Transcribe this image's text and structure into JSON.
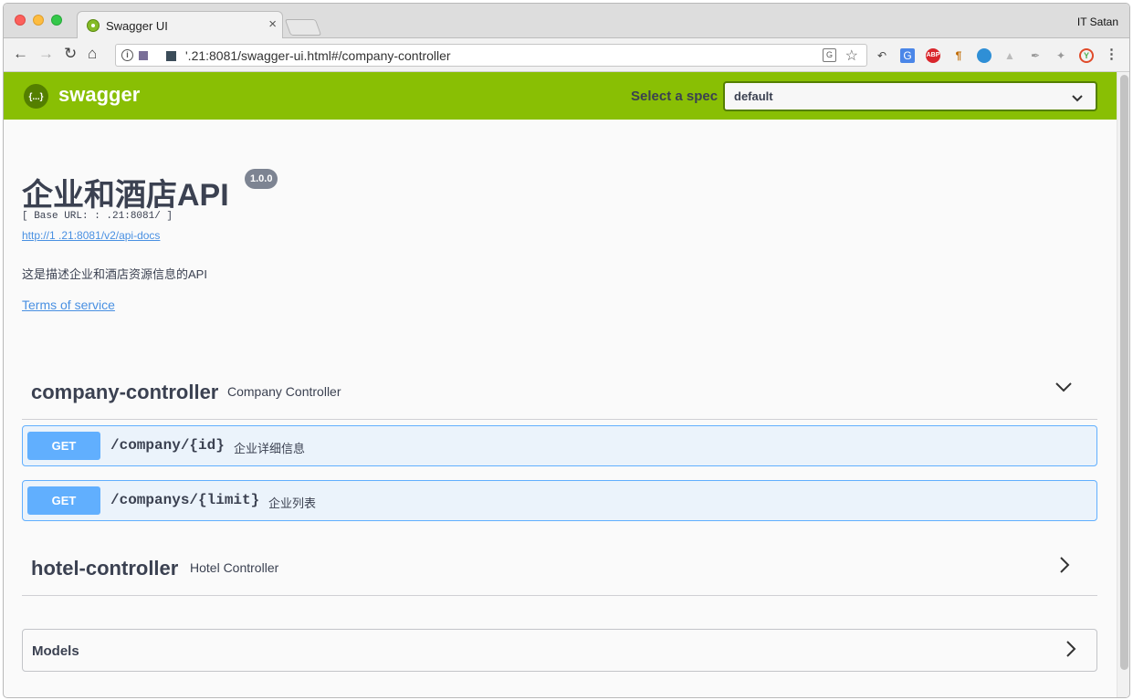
{
  "browser": {
    "tab_title": "Swagger UI",
    "tab_close": "×",
    "profile": "IT Satan",
    "url": "'.21:8081/swagger-ui.html#/company-controller"
  },
  "swagger": {
    "logo_text": "swagger",
    "logo_glyph": "{...}",
    "spec_label": "Select a spec",
    "spec_value": "default"
  },
  "info": {
    "title": "企业和酒店API",
    "version": "1.0.0",
    "base_url": "[ Base URL: :        .21:8081/ ]",
    "docs_link": "http://1       .21:8081/v2/api-docs",
    "description": "这是描述企业和酒店资源信息的API",
    "terms": "Terms of service"
  },
  "sections": [
    {
      "name": "company-controller",
      "description": "Company Controller",
      "expanded": true,
      "operations": [
        {
          "method": "GET",
          "path": "/company/{id}",
          "summary": "企业详细信息"
        },
        {
          "method": "GET",
          "path": "/companys/{limit}",
          "summary": "企业列表"
        }
      ]
    },
    {
      "name": "hotel-controller",
      "description": "Hotel Controller",
      "expanded": false
    }
  ],
  "models": {
    "title": "Models"
  },
  "colors": {
    "topbar": "#89bf04",
    "get_method": "#61affe",
    "link": "#4990e2",
    "text": "#3b4151"
  }
}
